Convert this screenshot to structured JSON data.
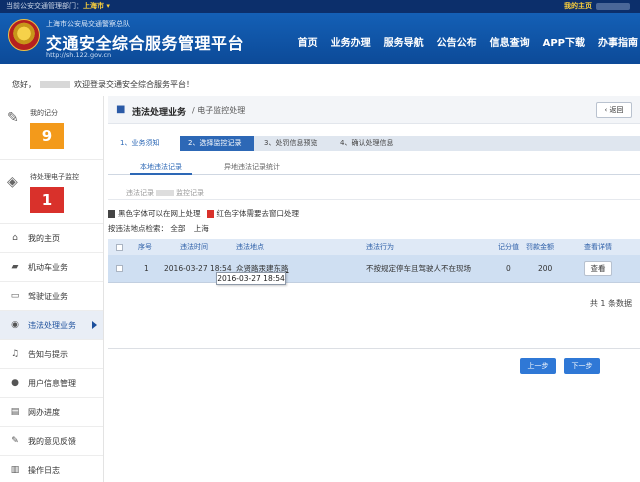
{
  "topbar": {
    "prefix": "当前公安交通管理部门：",
    "city": "上海市 ▾",
    "user_prefix": "我的主页"
  },
  "header": {
    "org": "上海市公安局交通警察总队",
    "title": "交通安全综合服务管理平台",
    "url": "http://sh.122.gov.cn",
    "nav": [
      "首页",
      "业务办理",
      "服务导航",
      "公告公布",
      "信息查询",
      "APP下载",
      "办事指南"
    ]
  },
  "welcome": {
    "hello": "您好，",
    "message": "欢迎登录交通安全综合服务平台！"
  },
  "sidebar": {
    "score_label": "我的记分",
    "score_value": "9",
    "pending_label": "待处理电子监控",
    "pending_value": "1",
    "menu": [
      {
        "label": "我的主页",
        "icon": "home-icon",
        "glyph": "⌂"
      },
      {
        "label": "机动车业务",
        "icon": "truck-icon",
        "glyph": "▰"
      },
      {
        "label": "驾驶证业务",
        "icon": "card-icon",
        "glyph": "▭"
      },
      {
        "label": "违法处理业务",
        "icon": "camera-icon",
        "glyph": "◉"
      },
      {
        "label": "告知与提示",
        "icon": "bell-icon",
        "glyph": "♫"
      },
      {
        "label": "用户信息管理",
        "icon": "user-icon",
        "glyph": "●"
      },
      {
        "label": "网办进度",
        "icon": "progress-icon",
        "glyph": "▤"
      },
      {
        "label": "我的意见反馈",
        "icon": "feedback-icon",
        "glyph": "✎"
      },
      {
        "label": "操作日志",
        "icon": "log-icon",
        "glyph": "▥"
      }
    ]
  },
  "main": {
    "breadcrumb_title": "违法处理业务",
    "breadcrumb_sub": "/ 电子监控处理",
    "back_label": "‹ 返回",
    "steps": [
      "1、业务须知",
      "2、选择监控记录",
      "3、处罚信息预览",
      "4、确认处理信息"
    ],
    "subtabs": [
      "本地违法记录",
      "异地违法记录统计"
    ],
    "second_tab_prefix": "违法记录",
    "second_tab_suffix": "监控记录",
    "legend_black": "黑色字体可以在网上处理",
    "legend_red": "红色字体需要去窗口处理",
    "place_label": "按违法地点检索：",
    "place_all": "全部",
    "place_city": "上海",
    "table": {
      "headers": [
        "序号",
        "违法时间",
        "违法地点",
        "违法行为",
        "记分值",
        "罚款金额",
        "查看详情"
      ],
      "rows": [
        {
          "index": "1",
          "time": "2016-03-27 18:54",
          "place": "众贤路汞建东路",
          "behavior": "不按规定停车且驾驶人不在现场",
          "score": "0",
          "fine": "200",
          "action": "查看"
        }
      ]
    },
    "tooltip": "2016-03-27 18:54",
    "total": "共 1 条数据",
    "prev": "上一步",
    "next": "下一步"
  },
  "colors": {
    "header_blue": "#1460b6",
    "accent": "#2d68b6",
    "score_orange": "#f39a1b",
    "pending_red": "#d9312b"
  }
}
